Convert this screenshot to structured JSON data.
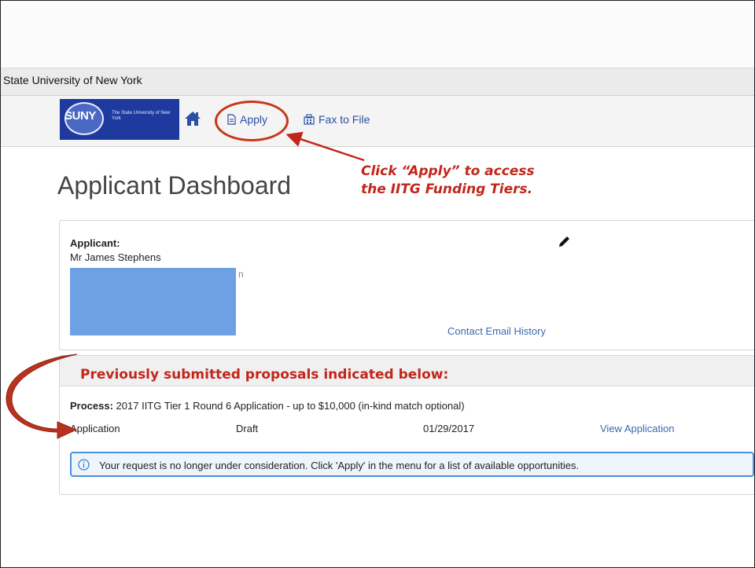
{
  "org_bar": {
    "name": "State University of New York"
  },
  "logo": {
    "mark": "SUNY",
    "subtitle": "The State University of New York"
  },
  "nav": {
    "home_icon": "home-icon",
    "apply_label": "Apply",
    "apply_icon": "document-icon",
    "fax_label": "Fax to File",
    "fax_icon": "fax-icon"
  },
  "page": {
    "title": "Applicant Dashboard"
  },
  "annotations": {
    "apply_callout_line1": "Click “Apply” to access",
    "apply_callout_line2": "the IITG Funding Tiers.",
    "previous_label": "Previously submitted proposals indicated below:",
    "accent_color": "#c2261a"
  },
  "applicant": {
    "label": "Applicant:",
    "name": "Mr James Stephens",
    "peek_char": "n",
    "edit_icon": "pencil-icon",
    "contact_link": "Contact Email History"
  },
  "process": {
    "label": "Process:",
    "name": "2017 IITG Tier 1 Round 6 Application - up to $10,000 (in-kind match optional)",
    "row": {
      "type": "Application",
      "status": "Draft",
      "date": "01/29/2017",
      "link": "View Application"
    }
  },
  "notice": {
    "icon": "info-icon",
    "text": "Your request is no longer under consideration. Click 'Apply' in the menu for a list of available opportunities."
  }
}
